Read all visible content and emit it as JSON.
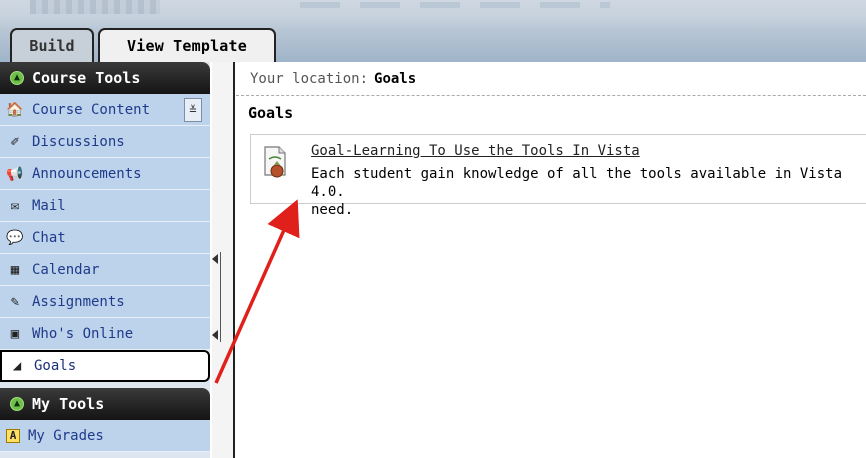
{
  "tabs": [
    {
      "label": "Build"
    },
    {
      "label": "View Template"
    }
  ],
  "sidebar": {
    "course_tools_header": "Course Tools",
    "items": [
      {
        "label": "Course Content",
        "icon": "course-content-icon",
        "glyph": "🏠"
      },
      {
        "label": "Discussions",
        "icon": "discussions-icon",
        "glyph": "✐"
      },
      {
        "label": "Announcements",
        "icon": "announcements-icon",
        "glyph": "📢"
      },
      {
        "label": "Mail",
        "icon": "mail-icon",
        "glyph": "✉"
      },
      {
        "label": "Chat",
        "icon": "chat-icon",
        "glyph": "💬"
      },
      {
        "label": "Calendar",
        "icon": "calendar-icon",
        "glyph": "▦"
      },
      {
        "label": "Assignments",
        "icon": "assignments-icon",
        "glyph": "✎"
      },
      {
        "label": "Who's Online",
        "icon": "whos-online-icon",
        "glyph": "▣"
      },
      {
        "label": "Goals",
        "icon": "goals-icon",
        "glyph": "◢"
      }
    ],
    "expand_glyph": "≚",
    "my_tools_header": "My Tools",
    "my_tools_items": [
      {
        "label": "My Grades",
        "icon": "my-grades-icon",
        "glyph": "A"
      }
    ]
  },
  "main": {
    "location_label": "Your location:",
    "location_value": "Goals",
    "section_title": "Goals",
    "goal": {
      "title": "Goal-Learning To Use the Tools In Vista",
      "description": "Each student gain knowledge of all the tools available in Vista 4.0.\nneed."
    }
  },
  "colors": {
    "nav_bg": "#bdd3ec",
    "nav_text": "#1f3a8a",
    "header_bg": "#1a1a1a",
    "annotation_arrow": "#e0201a"
  }
}
